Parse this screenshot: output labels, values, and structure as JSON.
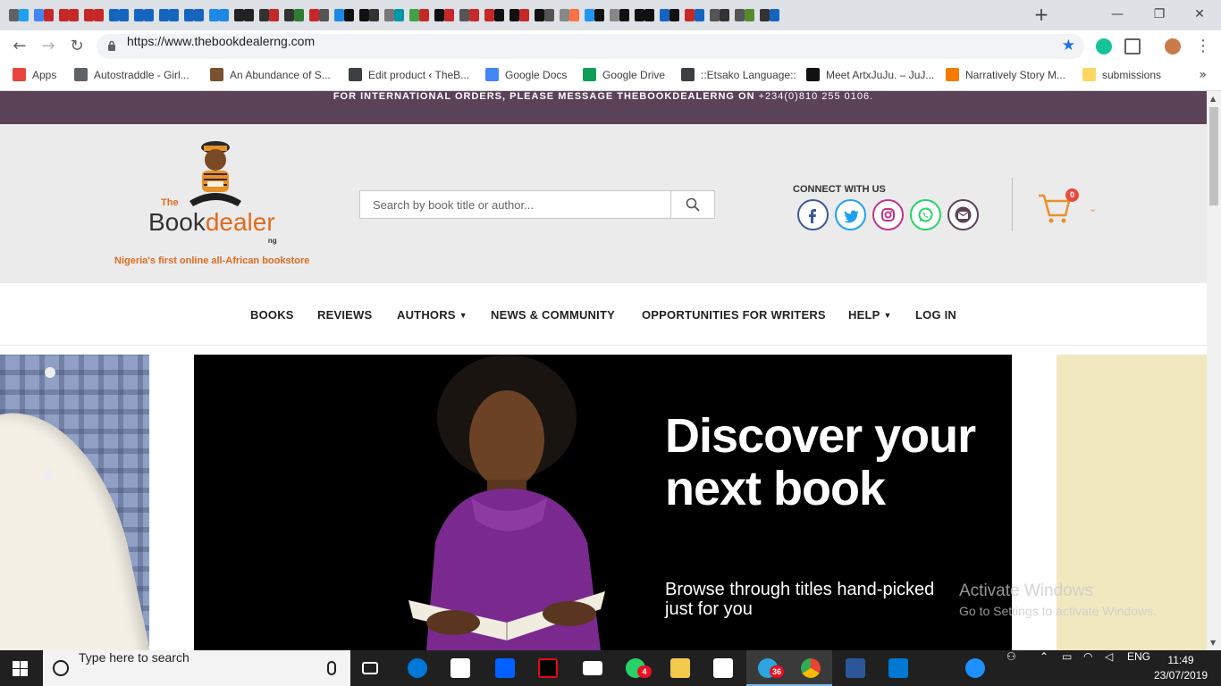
{
  "browser": {
    "url": "https://www.thebookdealerng.com",
    "new_tab": "+",
    "window_controls": {
      "minimize": "—",
      "restore": "❐",
      "close": "✕"
    },
    "nav": {
      "back": "←",
      "forward": "→",
      "reload": "↻"
    }
  },
  "bookmarks": {
    "items": [
      {
        "label": "Apps",
        "color": "#e8453c"
      },
      {
        "label": "Autostraddle - Girl...",
        "color": "#5f6368"
      },
      {
        "label": "An Abundance of S...",
        "color": "#7a5230"
      },
      {
        "label": "Edit product ‹ TheB...",
        "color": "#3c4043"
      },
      {
        "label": "Google Docs",
        "color": "#4285f4"
      },
      {
        "label": "Google Drive",
        "color": "#0f9d58"
      },
      {
        "label": "::Etsako Language::",
        "color": "#3c4043"
      },
      {
        "label": "Meet ArtxJuJu. – JuJ...",
        "color": "#111111"
      },
      {
        "label": "Narratively Story M...",
        "color": "#f57c00"
      },
      {
        "label": "submissions",
        "color": "#fdd663"
      }
    ],
    "more": "»"
  },
  "site": {
    "promo": {
      "text": "FOR INTERNATIONAL ORDERS, PLEASE MESSAGE THEBOOKDEALERNG ON ",
      "phone": "+234(0)810 255 0106."
    },
    "logo": {
      "the": "The",
      "book": "Book",
      "dealer": "dealer",
      "ng": "ng"
    },
    "tagline": "Nigeria's first online all-African bookstore",
    "search": {
      "placeholder": "Search by book title or author..."
    },
    "connect_label": "CONNECT WITH US",
    "social": [
      {
        "name": "facebook",
        "color": "#3b5998"
      },
      {
        "name": "twitter",
        "color": "#1da1f2"
      },
      {
        "name": "instagram",
        "color": "#c13584"
      },
      {
        "name": "whatsapp",
        "color": "#25d366"
      },
      {
        "name": "email",
        "color": "#5b4257"
      }
    ],
    "cart": {
      "count": "0",
      "color": "#e8902b"
    },
    "nav": [
      {
        "label": "BOOKS"
      },
      {
        "label": "REVIEWS"
      },
      {
        "label": "AUTHORS"
      },
      {
        "label": "NEWS & COMMUNITY"
      },
      {
        "label": "OPPORTUNITIES FOR WRITERS"
      },
      {
        "label": "HELP"
      },
      {
        "label": "LOG IN"
      }
    ],
    "hero": {
      "title": "Discover your next book",
      "subtitle": "Browse through titles hand-picked just for you"
    }
  },
  "os": {
    "watermark_title": "Activate Windows",
    "watermark_sub": "Go to Settings to activate Windows.",
    "search_placeholder": "Type here to search",
    "whatsapp_badge": "4",
    "telegram_badge": "36",
    "language": "ENG",
    "time": "11:49",
    "date": "23/07/2019"
  }
}
